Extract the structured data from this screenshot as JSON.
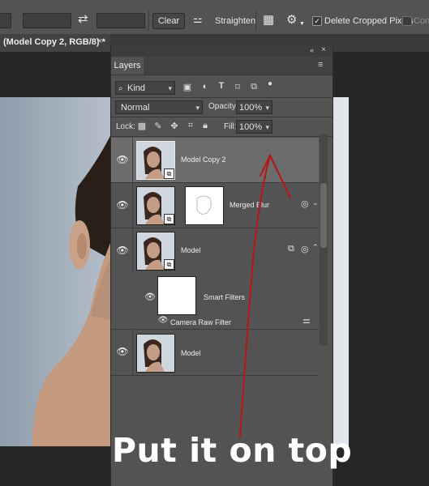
{
  "options_bar": {
    "clear_label": "Clear",
    "straighten_label": "Straighten",
    "delete_cropped_label": "Delete Cropped Pixels",
    "delete_cropped_checked": true,
    "content_aware_label": "Conte",
    "icons": [
      "swap-icon",
      "level-icon",
      "grid-overlay-icon",
      "gear-icon"
    ]
  },
  "document_tab": {
    "title": "(Model Copy 2, RGB/8) *",
    "close_glyph": "×"
  },
  "layers_panel": {
    "tab_label": "Layers",
    "filter": {
      "label": "Kind",
      "icons": [
        "image-filter-icon",
        "adjustment-filter-icon",
        "type-filter-icon",
        "shape-filter-icon",
        "smartobject-filter-icon",
        "filter-toggle-icon"
      ]
    },
    "blend_mode": "Normal",
    "opacity_label": "Opacity:",
    "opacity_value": "100%",
    "lock_label": "Lock:",
    "lock_icons": [
      "lock-transparent-icon",
      "lock-image-icon",
      "lock-position-icon",
      "lock-artboard-icon",
      "lock-all-icon"
    ],
    "fill_label": "Fill:",
    "fill_value": "100%",
    "layers": [
      {
        "name": "Model Copy 2",
        "selected": true,
        "visible": true,
        "smart_object": true
      },
      {
        "name": "Merged Blur",
        "selected": false,
        "visible": true,
        "smart_object": true,
        "has_mask": true
      },
      {
        "name": "Model",
        "selected": false,
        "visible": true,
        "smart_object": true,
        "expanded": true
      },
      {
        "name": "Model",
        "selected": false,
        "visible": true,
        "smart_object": false
      }
    ],
    "smart_filters_label": "Smart Filters",
    "camera_raw_label": "Camera Raw Filter"
  },
  "annotation": {
    "text": "Put it on top",
    "arrow_color": "#b11a1a"
  }
}
